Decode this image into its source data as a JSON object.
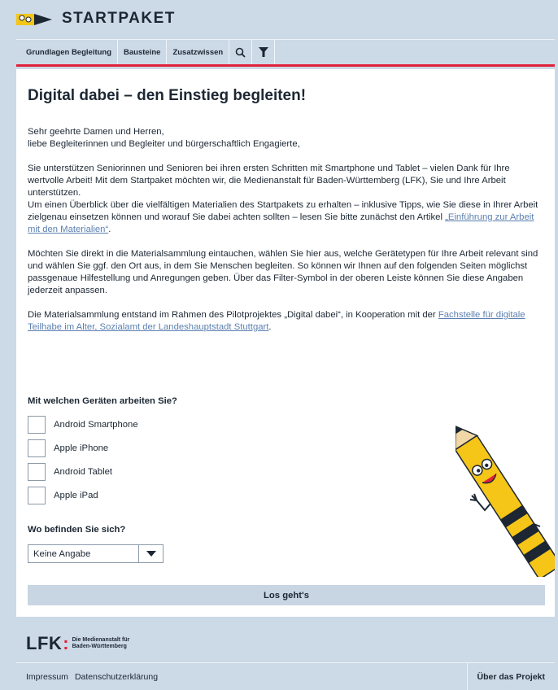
{
  "header": {
    "brand": "STARTPAKET",
    "nav": [
      "Grundlagen Begleitung",
      "Bausteine",
      "Zusatzwissen"
    ],
    "icons": [
      "search-icon",
      "filter-icon"
    ],
    "accent_color": "#e1213a"
  },
  "main": {
    "title": "Digital dabei – den Einstieg begleiten!",
    "greeting_1": "Sehr geehrte Damen und Herren,",
    "greeting_2": "liebe Begleiterinnen und Begleiter und bürgerschaftlich Engagierte,",
    "para1": "Sie unterstützen Seniorinnen und Senioren bei ihren ersten Schritten mit Smartphone und Tablet – vielen Dank für Ihre wertvolle Arbeit! Mit dem Startpaket möchten wir, die Medienanstalt für Baden-Württemberg (LFK), Sie und Ihre Arbeit unterstützen.",
    "para2_text": "Um einen Überblick über die vielfältigen Materialien des Startpakets zu erhalten – inklusive Tipps, wie Sie diese in Ihrer Arbeit zielgenau einsetzen können und worauf Sie dabei achten sollten – lesen Sie bitte zunächst den Artikel ",
    "para2_link": "„Einführung zur Arbeit mit den Materialien“",
    "para2_end": ".",
    "para3": "Möchten Sie direkt in die Materialsammlung eintauchen, wählen Sie hier aus, welche Gerätetypen für Ihre Arbeit relevant sind und wählen Sie ggf. den Ort aus, in dem Sie Menschen begleiten. So können wir Ihnen auf den folgenden Seiten möglichst passgenaue Hilfestellung und Anregungen geben. Über das Filter-Symbol in der oberen Leiste können Sie diese Angaben jederzeit anpassen.",
    "para4_text": "Die Materialsammlung entstand im Rahmen des Pilotprojektes „Digital dabei“, in Kooperation mit der ",
    "para4_link": "Fachstelle für digitale Teilhabe im Alter, Sozialamt der Landeshauptstadt Stuttgart",
    "para4_end": ".",
    "devices_question": "Mit welchen Geräten arbeiten Sie?",
    "devices": [
      "Android Smartphone",
      "Apple iPhone",
      "Android Tablet",
      "Apple iPad"
    ],
    "location_question": "Wo befinden Sie sich?",
    "location_selected": "Keine Angabe",
    "go_button": "Los geht's"
  },
  "footer": {
    "logo_text": "LFK",
    "logo_sub_1": "Die Medienanstalt für",
    "logo_sub_2": "Baden-Württemberg",
    "links": [
      "Impressum",
      "Datenschutzerklärung"
    ],
    "right_link": "Über das Projekt"
  }
}
